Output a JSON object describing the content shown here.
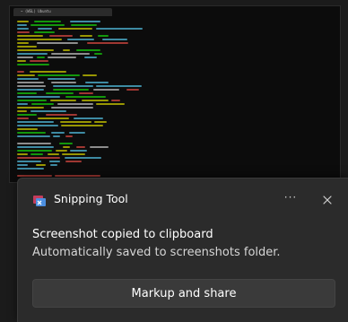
{
  "terminal": {
    "tab_label": "~ (WSL) Ubuntu"
  },
  "toast": {
    "app_name": "Snipping Tool",
    "app_icon": "snipping-tool-icon",
    "more_label": "···",
    "close_icon": "close-icon",
    "title": "Screenshot copied to clipboard",
    "body": "Automatically saved to screenshots folder.",
    "action_label": "Markup and share"
  },
  "colors": {
    "background": "#1b1b1b",
    "terminal_bg": "#0c0c0c",
    "toast_bg": "#2b2b2b",
    "button_bg": "#3a3a3a",
    "text_primary": "#ffffff",
    "text_secondary": "#d6d6d6",
    "term_green": "#16c60c",
    "term_yellow": "#c7c400",
    "term_cyan": "#4fb6d6",
    "term_red": "#d0453f",
    "term_white": "#b8b8b8"
  }
}
